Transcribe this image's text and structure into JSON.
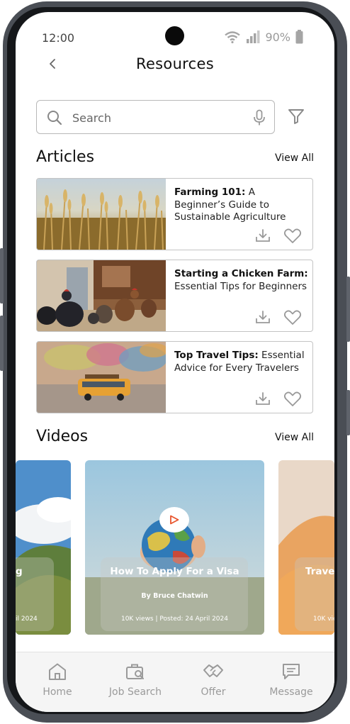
{
  "status_bar": {
    "time": "12:00",
    "battery": "90%"
  },
  "header": {
    "title": "Resources"
  },
  "search": {
    "placeholder": "Search"
  },
  "articles": {
    "heading": "Articles",
    "view_all": "View All",
    "items": [
      {
        "title_bold": "Farming 101:",
        "title_rest": " A Beginner’s Guide to Sustainable Agriculture"
      },
      {
        "title_bold": "Starting a Chicken Farm:",
        "title_rest": " Essential Tips for Beginners"
      },
      {
        "title_bold": "Top Travel Tips:",
        "title_rest": " Essential Advice for Every Travelers"
      }
    ]
  },
  "videos": {
    "heading": "Videos",
    "view_all": "View All",
    "left_title_fragment": "g",
    "left_meta_fragment": "il 2024",
    "featured": {
      "title": "How To Apply For a Visa",
      "author": "By Bruce Chatwin",
      "meta": "10K views | Posted: 24 April 2024"
    },
    "right_title_fragment": "Trave",
    "right_meta_fragment": "10K vie"
  },
  "nav": {
    "items": [
      {
        "label": "Home"
      },
      {
        "label": "Job Search"
      },
      {
        "label": "Offer"
      },
      {
        "label": "Message"
      }
    ]
  },
  "colors": {
    "accent": "#e8542c",
    "icon_gray": "#9a9a9a",
    "frame": "#4a4e55"
  }
}
